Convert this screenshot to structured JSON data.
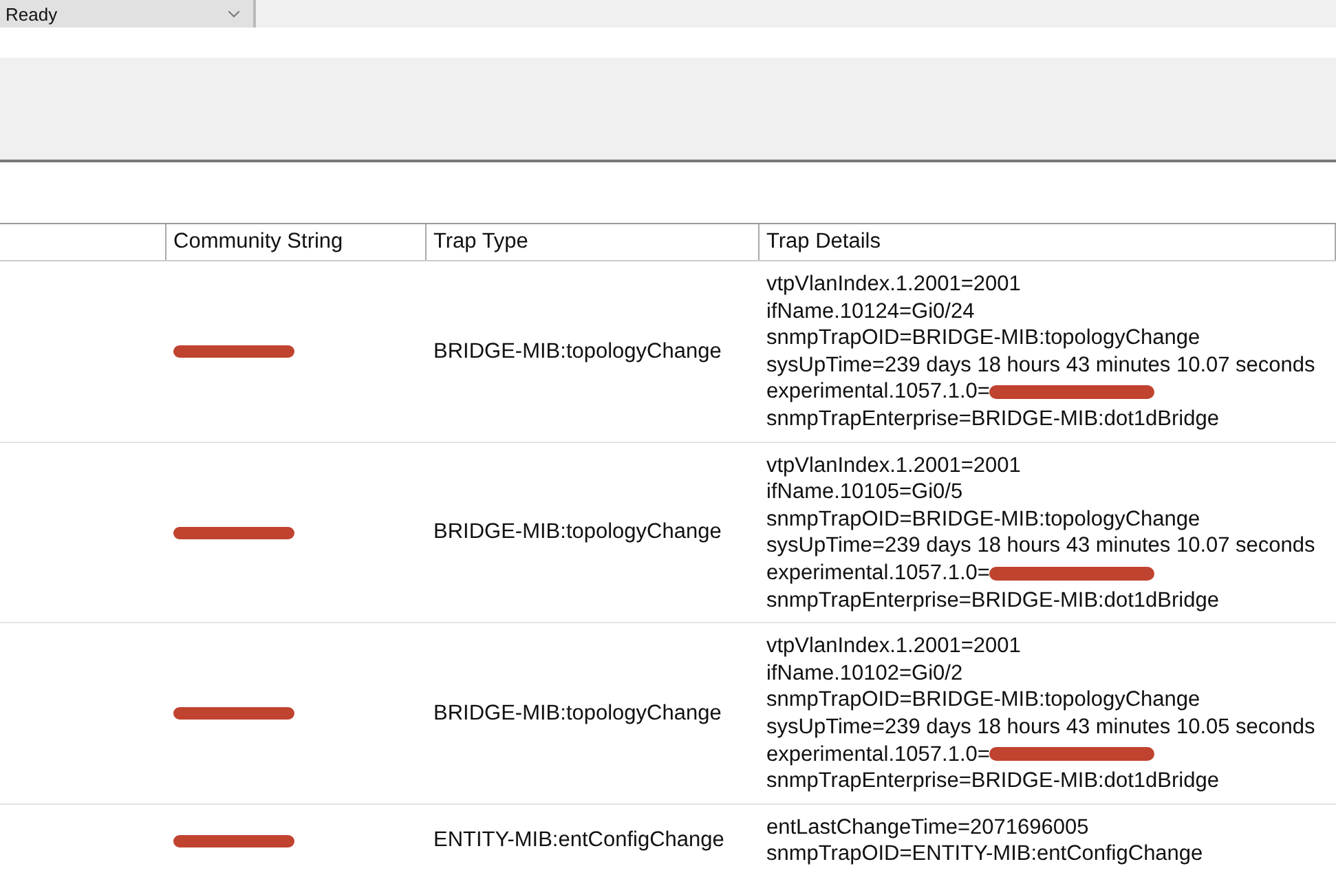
{
  "status_field": {
    "value": "Ready"
  },
  "table": {
    "columns": [
      "",
      "Community String",
      "Trap Type",
      "Trap Details"
    ],
    "rows": [
      {
        "community_redacted": true,
        "trap_type": "BRIDGE-MIB:topologyChange",
        "details": [
          {
            "text": "vtpVlanIndex.1.2001=2001",
            "redacted": false
          },
          {
            "text": "ifName.10124=Gi0/24",
            "redacted": false
          },
          {
            "text": "snmpTrapOID=BRIDGE-MIB:topologyChange",
            "redacted": false
          },
          {
            "text": "sysUpTime=239 days 18 hours 43 minutes 10.07 seconds",
            "redacted": false
          },
          {
            "text": "experimental.1057.1.0=",
            "redacted": true
          },
          {
            "text": "snmpTrapEnterprise=BRIDGE-MIB:dot1dBridge",
            "redacted": false
          }
        ]
      },
      {
        "community_redacted": true,
        "trap_type": "BRIDGE-MIB:topologyChange",
        "details": [
          {
            "text": "vtpVlanIndex.1.2001=2001",
            "redacted": false
          },
          {
            "text": "ifName.10105=Gi0/5",
            "redacted": false
          },
          {
            "text": "snmpTrapOID=BRIDGE-MIB:topologyChange",
            "redacted": false
          },
          {
            "text": "sysUpTime=239 days 18 hours 43 minutes 10.07 seconds",
            "redacted": false
          },
          {
            "text": "experimental.1057.1.0=",
            "redacted": true
          },
          {
            "text": "snmpTrapEnterprise=BRIDGE-MIB:dot1dBridge",
            "redacted": false
          }
        ]
      },
      {
        "community_redacted": true,
        "trap_type": "BRIDGE-MIB:topologyChange",
        "details": [
          {
            "text": "vtpVlanIndex.1.2001=2001",
            "redacted": false
          },
          {
            "text": "ifName.10102=Gi0/2",
            "redacted": false
          },
          {
            "text": "snmpTrapOID=BRIDGE-MIB:topologyChange",
            "redacted": false
          },
          {
            "text": "sysUpTime=239 days 18 hours 43 minutes 10.05 seconds",
            "redacted": false
          },
          {
            "text": "experimental.1057.1.0=",
            "redacted": true
          },
          {
            "text": "snmpTrapEnterprise=BRIDGE-MIB:dot1dBridge",
            "redacted": false
          }
        ]
      },
      {
        "community_redacted": true,
        "trap_type": "ENTITY-MIB:entConfigChange",
        "details": [
          {
            "text": "entLastChangeTime=2071696005",
            "redacted": false
          },
          {
            "text": "snmpTrapOID=ENTITY-MIB:entConfigChange",
            "redacted": false
          }
        ]
      }
    ]
  }
}
